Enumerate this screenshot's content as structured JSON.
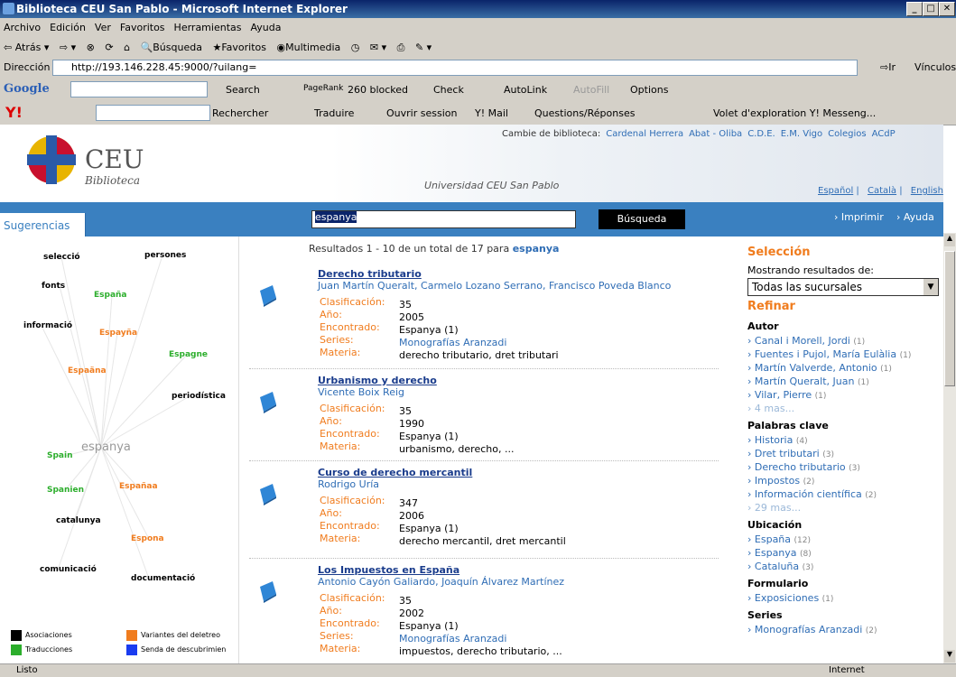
{
  "window": {
    "title": "Biblioteca CEU San Pablo - Microsoft Internet Explorer"
  },
  "menu": [
    "Archivo",
    "Edición",
    "Ver",
    "Favoritos",
    "Herramientas",
    "Ayuda"
  ],
  "toolbar": {
    "back": "Atrás",
    "search": "Búsqueda",
    "favorites": "Favoritos",
    "multimedia": "Multimedia"
  },
  "address": {
    "label": "Dirección",
    "url": "http://193.146.228.45:9000/?uilang=",
    "go": "Ir",
    "links": "Vínculos"
  },
  "google_bar": {
    "logo": "Google",
    "search": "Search",
    "pagerank": "PageRank",
    "blocked": "260 blocked",
    "check": "Check",
    "autolink": "AutoLink",
    "autofill": "AutoFill",
    "options": "Options"
  },
  "yahoo_bar": {
    "rechercher": "Rechercher",
    "traduire": "Traduire",
    "session": "Ouvrir session",
    "mail": "Y! Mail",
    "qa": "Questions/Réponses",
    "volet": "Volet d'exploration Y! Messeng..."
  },
  "header": {
    "logo": "CEU",
    "logo_sub": "Biblioteca",
    "university": "Universidad CEU San Pablo",
    "cambie_label": "Cambie de biblioteca:",
    "libraries": [
      "Cardenal Herrera",
      "Abat - Oliba",
      "C.D.E.",
      "E.M. Vigo",
      "Colegios",
      "ACdP"
    ],
    "languages": [
      "Español",
      "Català",
      "English"
    ]
  },
  "searchbar": {
    "tab": "Sugerencias",
    "query": "espanya",
    "button": "Búsqueda",
    "print": "› Imprimir",
    "help": "› Ayuda"
  },
  "cloud": {
    "center": "espanya",
    "words": [
      {
        "text": "selecció",
        "c": "blk"
      },
      {
        "text": "persones",
        "c": "blk"
      },
      {
        "text": "fonts",
        "c": "blk"
      },
      {
        "text": "España",
        "c": "grn"
      },
      {
        "text": "informació",
        "c": "blk"
      },
      {
        "text": "Espayña",
        "c": "org"
      },
      {
        "text": "Espagne",
        "c": "grn"
      },
      {
        "text": "Espaäna",
        "c": "org"
      },
      {
        "text": "periodística",
        "c": "blk"
      },
      {
        "text": "Spain",
        "c": "grn"
      },
      {
        "text": "Españaa",
        "c": "org"
      },
      {
        "text": "Spanien",
        "c": "grn"
      },
      {
        "text": "catalunya",
        "c": "blk"
      },
      {
        "text": "Espona",
        "c": "org"
      },
      {
        "text": "comunicació",
        "c": "blk"
      },
      {
        "text": "documentació",
        "c": "blk"
      }
    ],
    "legend": [
      {
        "label": "Asociaciones",
        "color": "#000000"
      },
      {
        "label": "Variantes del deletreo",
        "color": "#f07c1e"
      },
      {
        "label": "Traducciones",
        "color": "#2cae2c"
      },
      {
        "label": "Senda de descubrimien",
        "color": "#1a3cf0"
      }
    ]
  },
  "results": {
    "summary_prefix": "Resultados 1 - 10 de un total de 17 para",
    "summary_term": "espanya",
    "records": [
      {
        "title": "Derecho tributario",
        "authors": "Juan Martín Queralt,  Carmelo Lozano Serrano,  Francisco Poveda Blanco",
        "fields": [
          [
            "Clasificación:",
            "35"
          ],
          [
            "Año:",
            "2005"
          ],
          [
            "Encontrado:",
            "Espanya (1)"
          ],
          [
            "Series:",
            "Monografías Aranzadi"
          ],
          [
            "Materia:",
            "derecho tributario, dret tributari"
          ]
        ]
      },
      {
        "title": "Urbanismo y derecho",
        "authors": "Vicente Boix Reig",
        "fields": [
          [
            "Clasificación:",
            "35"
          ],
          [
            "Año:",
            "1990"
          ],
          [
            "Encontrado:",
            "Espanya (1)"
          ],
          [
            "Materia:",
            "urbanismo, derecho, ..."
          ]
        ]
      },
      {
        "title": "Curso de derecho mercantil",
        "authors": "Rodrigo Uría",
        "fields": [
          [
            "Clasificación:",
            "347"
          ],
          [
            "Año:",
            "2006"
          ],
          [
            "Encontrado:",
            "Espanya (1)"
          ],
          [
            "Materia:",
            "derecho mercantil, dret mercantil"
          ]
        ]
      },
      {
        "title": "Los Impuestos en España",
        "authors": "Antonio Cayón Galiardo,  Joaquín Álvarez Martínez",
        "fields": [
          [
            "Clasificación:",
            "35"
          ],
          [
            "Año:",
            "2002"
          ],
          [
            "Encontrado:",
            "Espanya (1)"
          ],
          [
            "Series:",
            "Monografías Aranzadi"
          ],
          [
            "Materia:",
            "impuestos, derecho tributario, ..."
          ]
        ]
      }
    ]
  },
  "refine": {
    "seleccion": "Selección",
    "mostrando": "Mostrando resultados de:",
    "select_value": "Todas las sucursales",
    "refinar": "Refinar",
    "groups": [
      {
        "name": "Autor",
        "items": [
          [
            "Canal i Morell, Jordi",
            "(1)"
          ],
          [
            "Fuentes i Pujol, María Eulàlia",
            "(1)"
          ],
          [
            "Martín Valverde, Antonio",
            "(1)"
          ],
          [
            "Martín Queralt, Juan",
            "(1)"
          ],
          [
            "Vilar, Pierre",
            "(1)"
          ]
        ],
        "more": "4 mas..."
      },
      {
        "name": "Palabras clave",
        "items": [
          [
            "Historia",
            "(4)"
          ],
          [
            "Dret tributari",
            "(3)"
          ],
          [
            "Derecho tributario",
            "(3)"
          ],
          [
            "Impostos",
            "(2)"
          ],
          [
            "Información científica",
            "(2)"
          ]
        ],
        "more": "29 mas..."
      },
      {
        "name": "Ubicación",
        "items": [
          [
            "España",
            "(12)"
          ],
          [
            "Espanya",
            "(8)"
          ],
          [
            "Cataluña",
            "(3)"
          ]
        ]
      },
      {
        "name": "Formulario",
        "items": [
          [
            "Exposiciones",
            "(1)"
          ]
        ]
      },
      {
        "name": "Series",
        "items": [
          [
            "Monografías Aranzadi",
            "(2)"
          ]
        ]
      }
    ]
  },
  "status": {
    "left": "Listo",
    "zone": "Internet"
  }
}
